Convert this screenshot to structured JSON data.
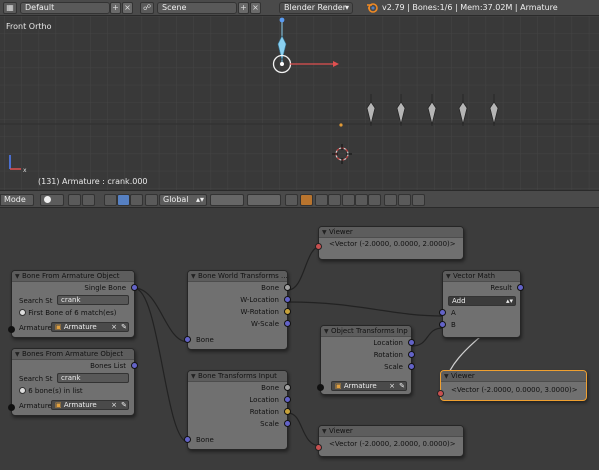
{
  "header": {
    "layout": "Default",
    "scene": "Scene",
    "engine": "Blender Render",
    "stats": "v2.79 | Bones:1/6 | Mem:37.02M | Armature"
  },
  "view3d": {
    "title": "Front Ortho",
    "status": "(131) Armature : crank.000"
  },
  "view_header": {
    "mode": "Mode",
    "orientation": "Global"
  },
  "nodes": {
    "bone_from_armature": {
      "title": "Bone From Armature Object",
      "output_label": "Single Bone",
      "search_label": "Search St",
      "search_value": "crank",
      "info": "First Bone of 6 match(es)",
      "armature_label": "Armature",
      "armature_value": "Armature"
    },
    "bones_from_armature": {
      "title": "Bones From Armature Object",
      "output_label": "Bones List",
      "search_label": "Search St",
      "search_value": "crank",
      "info": "6 bone(s) in list",
      "armature_label": "Armature",
      "armature_value": "Armature"
    },
    "bone_world_transforms": {
      "title": "Bone World Transforms ...",
      "outputs": [
        "Bone",
        "W-Location",
        "W-Rotation",
        "W-Scale"
      ],
      "input_label": "Bone"
    },
    "bone_transforms_input": {
      "title": "Bone Transforms Input",
      "outputs": [
        "Bone",
        "Location",
        "Rotation",
        "Scale"
      ],
      "input_label": "Bone"
    },
    "viewer_top": {
      "title": "Viewer",
      "value": "<Vector (-2.0000, 0.0000, 2.0000)>"
    },
    "object_transforms": {
      "title": "Object Transforms Inp",
      "outputs": [
        "Location",
        "Rotation",
        "Scale"
      ],
      "object_value": "Armature"
    },
    "vector_math": {
      "title": "Vector Math",
      "output_label": "Result",
      "operation": "Add",
      "inputs": [
        "A",
        "B"
      ]
    },
    "viewer_right": {
      "title": "Viewer",
      "value": "<Vector (-2.0000, 0.0000, 3.0000)>"
    },
    "viewer_bottom": {
      "title": "Viewer",
      "value": "<Vector (-2.0000, 2.0000, 0.0000)>"
    }
  },
  "colors": {
    "selection": "#f0a030",
    "vector_socket": "#6363c7",
    "rotation_socket": "#c7a23a",
    "object_socket": "#111111",
    "axis_x": "#e05050",
    "axis_y": "#60c060",
    "axis_z": "#5080ff"
  }
}
